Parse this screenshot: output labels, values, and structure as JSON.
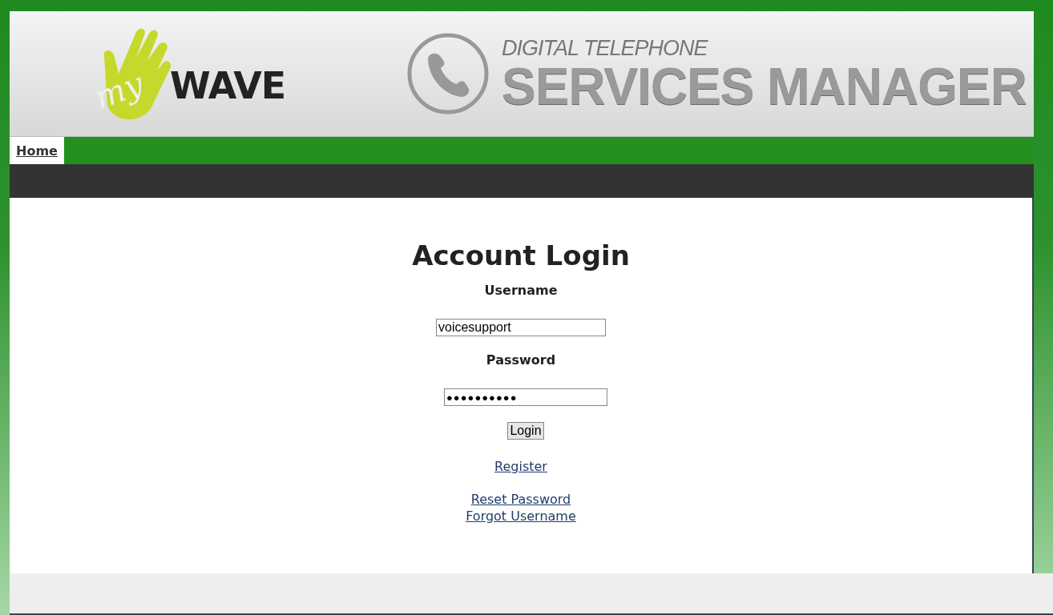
{
  "header": {
    "logo": {
      "script": "my",
      "word": "WAVE"
    },
    "title": {
      "kicker": "DIGITAL TELEPHONE",
      "main": "SERVICES MANAGER"
    }
  },
  "nav": {
    "items": [
      {
        "label": "Home",
        "selected": true
      }
    ]
  },
  "login": {
    "title": "Account Login",
    "fields": [
      {
        "label": "Username",
        "value": "voicesupport",
        "kind": "text"
      },
      {
        "label": "Password",
        "value": "●●●●●●●●●●",
        "kind": "password"
      }
    ],
    "button": "Login",
    "link_groups": [
      {
        "links": [
          {
            "label": "Register"
          }
        ]
      },
      {
        "links": [
          {
            "label": "Reset Password"
          },
          {
            "label": "Forgot Username"
          }
        ]
      }
    ]
  }
}
